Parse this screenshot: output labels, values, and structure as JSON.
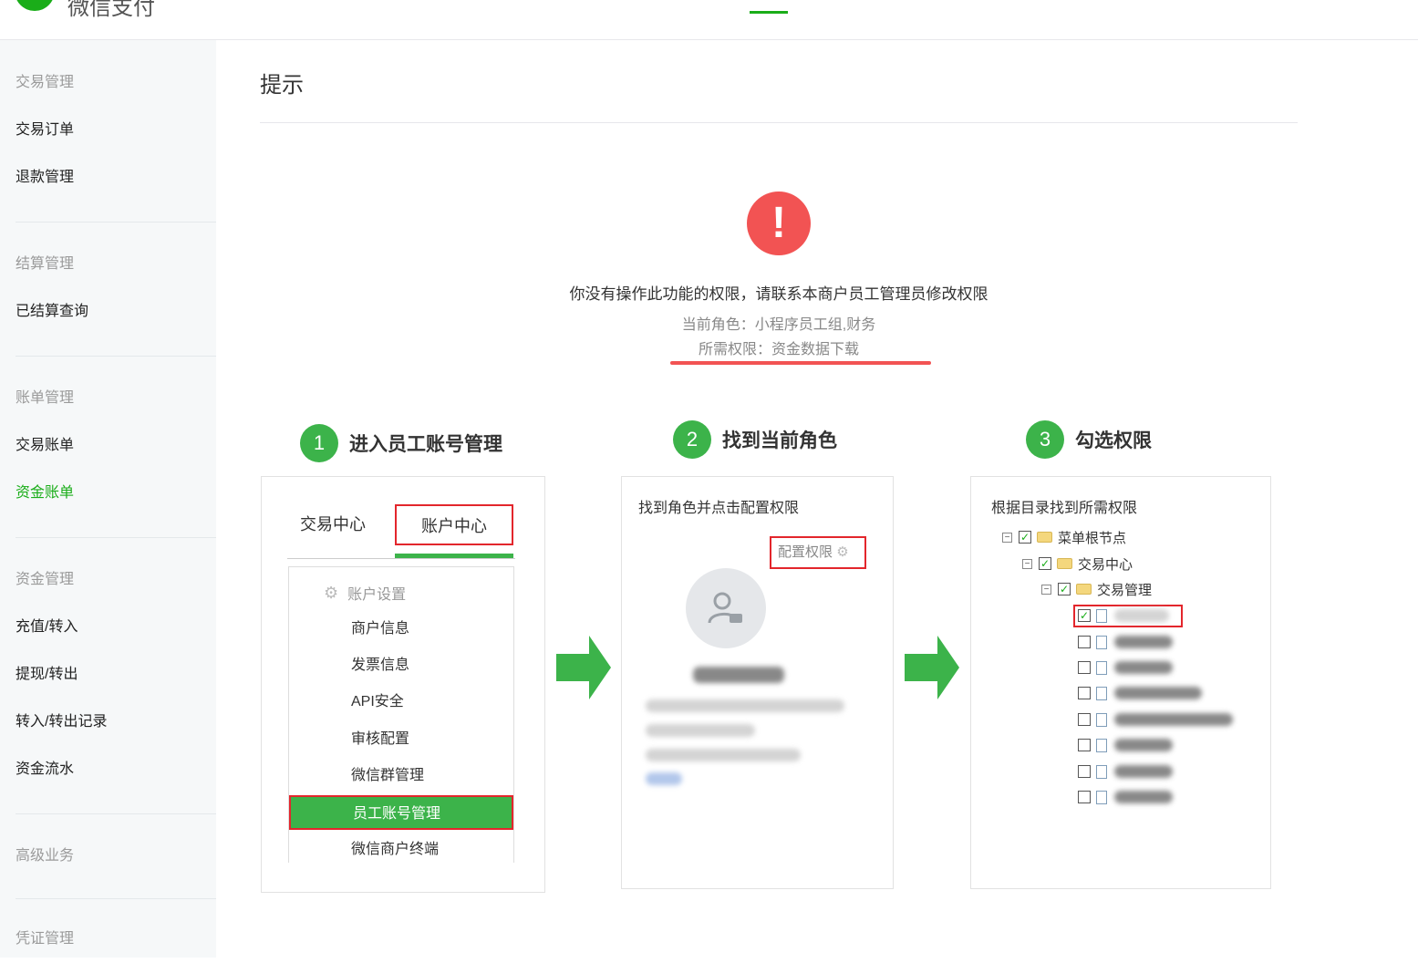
{
  "header": {
    "logo_text": "微信支付"
  },
  "sidebar": {
    "groups": [
      {
        "title": "交易管理",
        "items": [
          "交易订单",
          "退款管理"
        ]
      },
      {
        "title": "结算管理",
        "items": [
          "已结算查询"
        ]
      },
      {
        "title": "账单管理",
        "items": [
          "交易账单",
          "资金账单"
        ]
      },
      {
        "title": "资金管理",
        "items": [
          "充值/转入",
          "提现/转出",
          "转入/转出记录",
          "资金流水"
        ]
      },
      {
        "title": "高级业务",
        "items": []
      },
      {
        "title": "凭证管理",
        "items": []
      }
    ],
    "active_item": "资金账单"
  },
  "main": {
    "title": "提示",
    "alert_icon": "!",
    "message": "你没有操作此功能的权限，请联系本商户员工管理员修改权限",
    "current_role": "当前角色：小程序员工组,财务",
    "required_perm": "所需权限：资金数据下载",
    "accent_color": "#3cb34a",
    "alert_color": "#f25353"
  },
  "steps": [
    {
      "num": "1",
      "label": "进入员工账号管理"
    },
    {
      "num": "2",
      "label": "找到当前角色"
    },
    {
      "num": "3",
      "label": "勾选权限"
    }
  ],
  "card1": {
    "tab1": "交易中心",
    "tab2": "账户中心",
    "menu_head": "账户设置",
    "menu_items": [
      "商户信息",
      "发票信息",
      "API安全",
      "审核配置",
      "微信群管理",
      "员工账号管理",
      "微信商户终端"
    ],
    "active_menu": "员工账号管理"
  },
  "card2": {
    "title": "找到角色并点击配置权限",
    "config_label": "配置权限"
  },
  "card3": {
    "title": "根据目录找到所需权限",
    "tree": {
      "root": "菜单根节点",
      "level1": "交易中心",
      "level2": "交易管理"
    }
  }
}
